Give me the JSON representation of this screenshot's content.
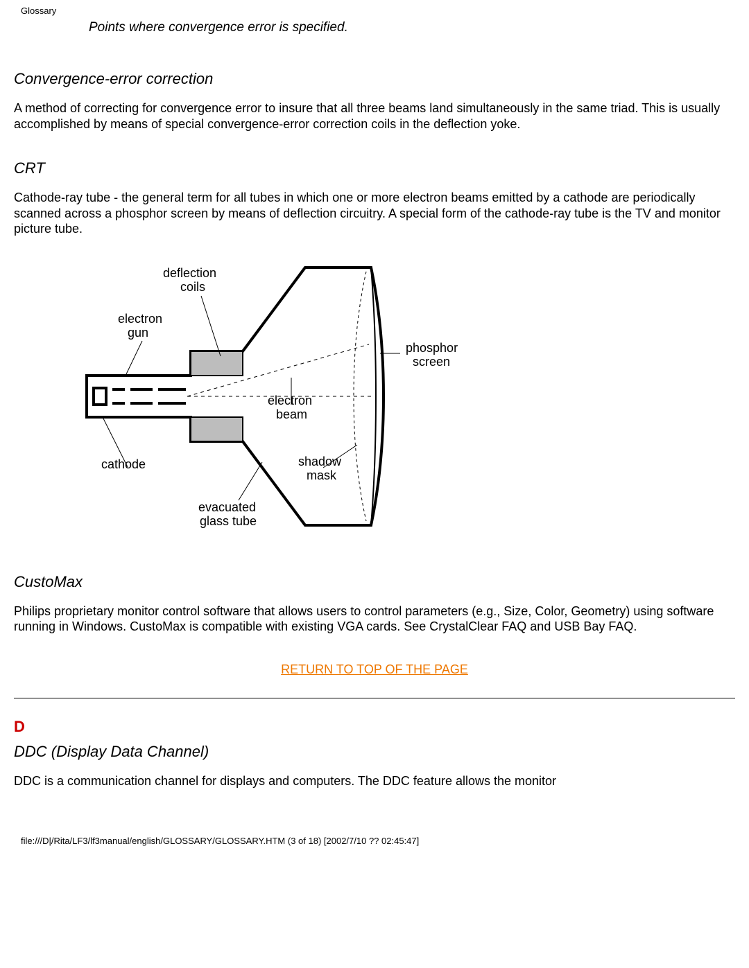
{
  "breadcrumb": "Glossary",
  "caption": "Points where convergence error is specified.",
  "entries": {
    "conv_err": {
      "term": "Convergence-error correction",
      "def": "A method of correcting for convergence error to insure that all three beams land simultaneously in the same triad. This is usually accomplished by means of special convergence-error correction coils in the deflection yoke."
    },
    "crt": {
      "term": "CRT",
      "def": "Cathode-ray tube - the general term for all tubes in which one or more electron beams emitted by a cathode are periodically scanned across a phosphor screen by means of deflection circuitry. A special form of the cathode-ray tube is the TV and monitor picture tube."
    },
    "customax": {
      "term": "CustoMax",
      "def": "Philips proprietary monitor control software that allows users to control parameters (e.g., Size, Color, Geometry) using software running in Windows. CustoMax is compatible with existing VGA cards. See CrystalClear FAQ and USB Bay FAQ."
    },
    "ddc": {
      "term": "DDC (Display Data Channel)",
      "def": "DDC is a communication channel for displays and computers. The DDC feature allows the monitor"
    }
  },
  "fig_labels": {
    "deflection_coils": "deflection\ncoils",
    "electron_gun": "electron\ngun",
    "phosphor_screen": "phosphor\nscreen",
    "electron_beam": "electron\nbeam",
    "cathode": "cathode",
    "shadow_mask": "shadow\nmask",
    "evacuated_glass_tube": "evacuated\nglass tube"
  },
  "return_link_label": "RETURN TO TOP OF THE PAGE",
  "letter_heading": "D",
  "footer_path": "file:///D|/Rita/LF3/lf3manual/english/GLOSSARY/GLOSSARY.HTM (3 of 18) [2002/7/10 ?? 02:45:47]"
}
